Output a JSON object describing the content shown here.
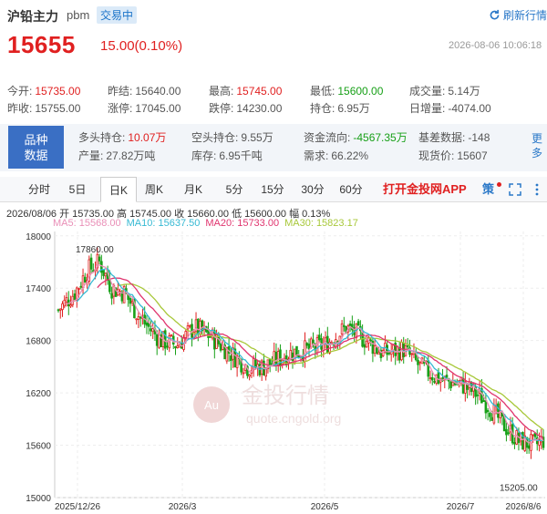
{
  "header": {
    "name": "沪铅主力",
    "code": "pbm",
    "status": "交易中",
    "refresh": "刷新行情",
    "price": "15655",
    "change": "15.00(0.10%)",
    "time": "2026-08-06 10:06:18"
  },
  "stats": [
    {
      "label": "今开:",
      "value": "15735.00",
      "color": "red"
    },
    {
      "label": "昨结:",
      "value": "15640.00",
      "color": ""
    },
    {
      "label": "最高:",
      "value": "15745.00",
      "color": "red"
    },
    {
      "label": "最低:",
      "value": "15600.00",
      "color": "green"
    },
    {
      "label": "成交量:",
      "value": "5.14万",
      "color": ""
    },
    {
      "label": "昨收:",
      "value": "15755.00",
      "color": ""
    },
    {
      "label": "涨停:",
      "value": "17045.00",
      "color": ""
    },
    {
      "label": "跌停:",
      "value": "14230.00",
      "color": ""
    },
    {
      "label": "持仓:",
      "value": "6.95万",
      "color": ""
    },
    {
      "label": "日增量:",
      "value": "-4074.00",
      "color": ""
    }
  ],
  "variety": {
    "label1": "品种",
    "label2": "数据",
    "more": "更多",
    "items": [
      {
        "label": "多头持仓:",
        "value": "10.07万",
        "color": "red"
      },
      {
        "label": "空头持仓:",
        "value": "9.55万",
        "color": ""
      },
      {
        "label": "资金流向:",
        "value": "-4567.35万",
        "color": "green"
      },
      {
        "label": "基差数据:",
        "value": "-148",
        "color": ""
      },
      {
        "label": "产量:",
        "value": "27.82万吨",
        "color": ""
      },
      {
        "label": "库存:",
        "value": "6.95千吨",
        "color": ""
      },
      {
        "label": "需求:",
        "value": "66.22%",
        "color": ""
      },
      {
        "label": "现货价:",
        "value": "15607",
        "color": ""
      }
    ]
  },
  "tabs": [
    "分时",
    "5日",
    "日K",
    "周K",
    "月K",
    "5分",
    "15分",
    "30分",
    "60分"
  ],
  "active_tab": "日K",
  "app_link": "打开金投网APP",
  "tool_char": "策",
  "ohlc": "2026/08/06  开 15735.00  高 15745.00  收 15660.00  低 15600.00  幅 0.13%",
  "ma": [
    {
      "label": "MA5: 15568.00",
      "color": "#e98fb7"
    },
    {
      "label": "MA10: 15637.50",
      "color": "#36b9d3"
    },
    {
      "label": "MA20: 15733.00",
      "color": "#e0356f"
    },
    {
      "label": "MA30: 15823.17",
      "color": "#a8c83a"
    }
  ],
  "watermark": {
    "brand": "金投行情",
    "url": "quote.cngold.org",
    "logo": "Au"
  },
  "chart_data": {
    "type": "candlestick",
    "y_ticks": [
      15000,
      15600,
      16200,
      16800,
      17400,
      18000
    ],
    "x_ticks": [
      "2025/12/26",
      "2026/3",
      "2026/5",
      "2026/7",
      "2026/8/6"
    ],
    "max_label": "17860.00",
    "min_label": "15205.00",
    "ylim": [
      15000,
      18050
    ],
    "ma_colors": {
      "ma5": "#e98fb7",
      "ma10": "#36b9d3",
      "ma20": "#e0356f",
      "ma30": "#a8c83a"
    },
    "up_color": "#e02020",
    "down_color": "#18a018"
  }
}
